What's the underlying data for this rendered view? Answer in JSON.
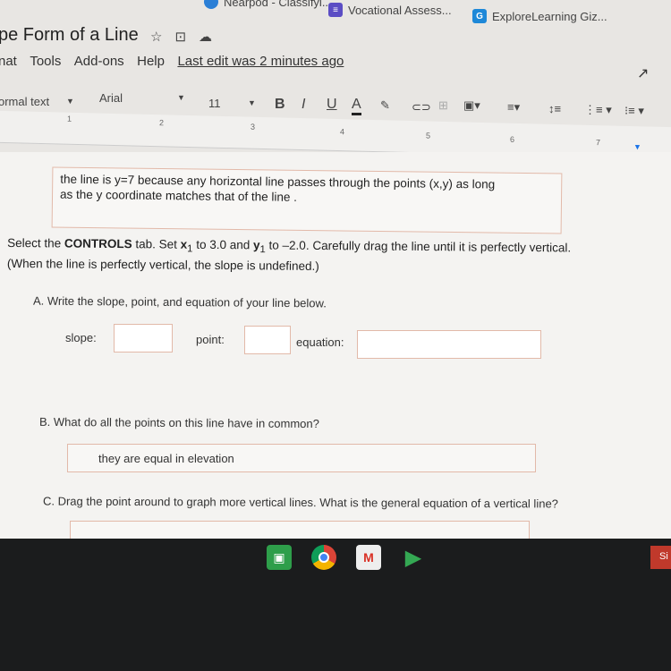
{
  "bookmarks": [
    {
      "label": "Nearpod - Classifyi...",
      "icon": "nearpod-icon",
      "color": "#2b7fd6"
    },
    {
      "label": "Vocational Assess...",
      "icon": "forms-icon",
      "color": "#5b4dc4"
    },
    {
      "label": "ExploreLearning Giz...",
      "icon": "G",
      "color": "#1e88d8"
    }
  ],
  "doc": {
    "title": "pe Form of a Line",
    "icons": [
      "star-icon",
      "move-to-folder-icon",
      "cloud-status-icon"
    ]
  },
  "menu": {
    "items": [
      "nat",
      "Tools",
      "Add-ons",
      "Help"
    ],
    "last_edit": "Last edit was 2 minutes ago"
  },
  "toolbar": {
    "style": "ormal text",
    "font": "Arial",
    "size": "11",
    "bold": "B",
    "italic": "I",
    "underline": "U",
    "color": "A"
  },
  "ruler": [
    "1",
    "2",
    "3",
    "4",
    "5",
    "6",
    "7"
  ],
  "content": {
    "answer_prev_line1": "the line is y=7 because any horizontal line passes through the points (x,y) as long",
    "answer_prev_line2": "as the y coordinate matches that of the line .",
    "instr_pre": "Select the ",
    "instr_bold": "CONTROLS",
    "instr_mid1": " tab. Set ",
    "x1": "x",
    "sub": "1",
    "instr_mid2": " to 3.0 and ",
    "y1": "y",
    "instr_post": " to –2.0. Carefully drag the line until it is perfectly vertical.",
    "instr_line2": "(When the line is perfectly vertical, the slope is undefined.)",
    "qA": "A.  Write the slope, point, and equation of your line below.",
    "slope_label": "slope:",
    "point_label": "point:",
    "equation_label": "equation:",
    "slope_value": "",
    "point_value": "",
    "equation_value": "",
    "qB": "B.  What do all the points on this line have in common?",
    "answerB": "they are equal in elevation",
    "qC": "C.  Drag the point around to graph more vertical lines. What is the general equation of a vertical line?"
  },
  "taskbar": {
    "apps": [
      "classroom-icon",
      "chrome-icon",
      "gmail-icon",
      "play-store-icon"
    ],
    "signin": "Si"
  }
}
